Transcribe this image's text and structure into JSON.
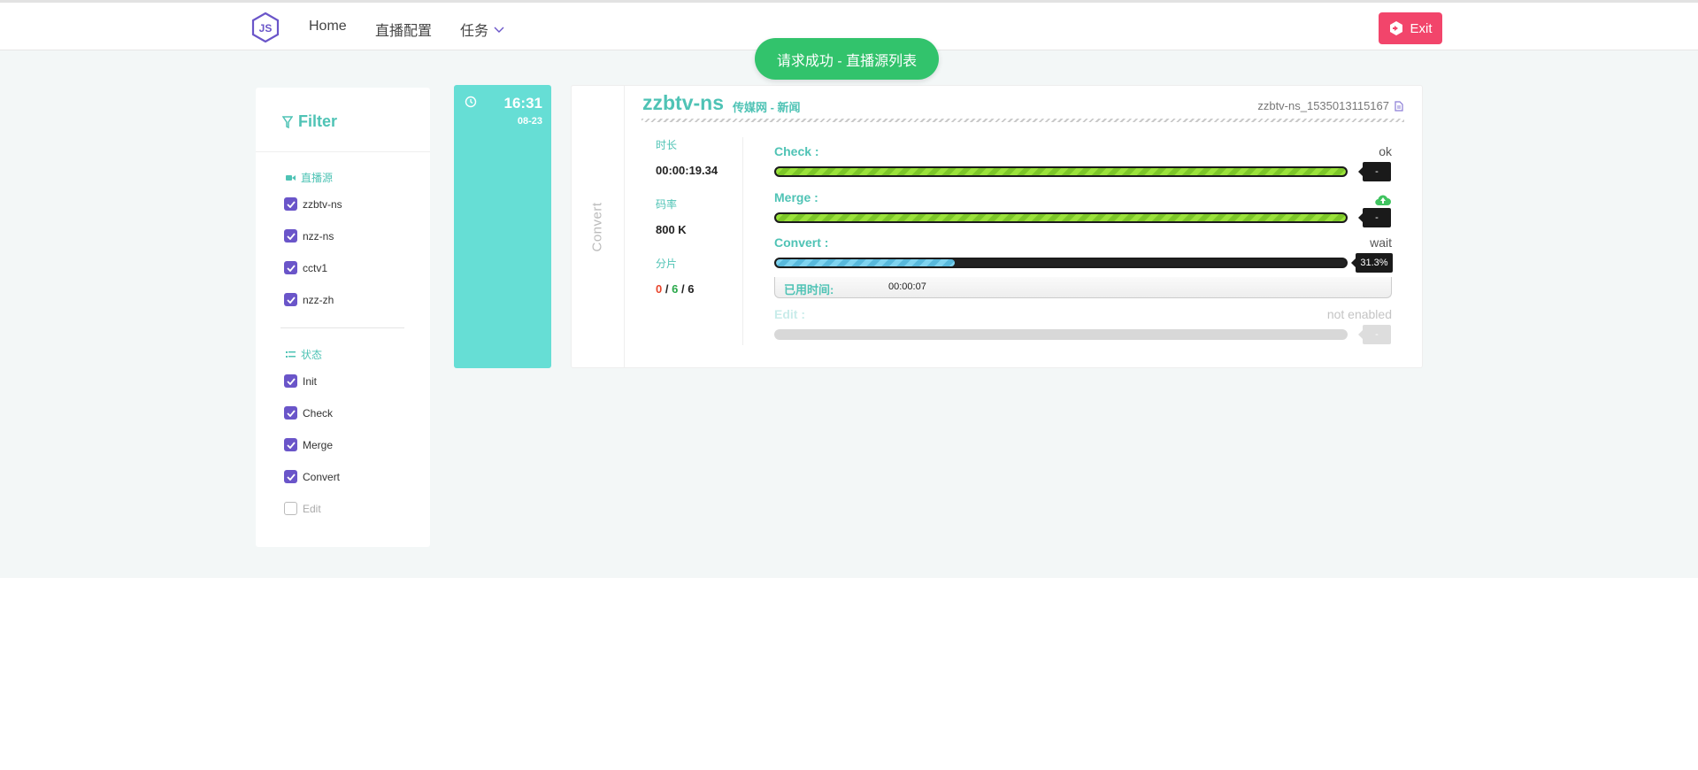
{
  "topbar": {
    "nav": [
      "Home",
      "直播配置",
      "任务"
    ],
    "exit_label": "Exit",
    "brand_color": "#6a55c9",
    "exit_color": "#f2456b"
  },
  "toast": {
    "message": "请求成功 - 直播源列表",
    "color": "#32c36c"
  },
  "filter": {
    "title": "Filter",
    "sources_title": "直播源",
    "sources": [
      {
        "label": "zzbtv-ns",
        "checked": true
      },
      {
        "label": "nzz-ns",
        "checked": true
      },
      {
        "label": "cctv1",
        "checked": true
      },
      {
        "label": "nzz-zh",
        "checked": true
      }
    ],
    "status_title": "状态",
    "statuses": [
      {
        "label": "Init",
        "checked": true
      },
      {
        "label": "Check",
        "checked": true
      },
      {
        "label": "Merge",
        "checked": true
      },
      {
        "label": "Convert",
        "checked": true
      },
      {
        "label": "Edit",
        "checked": false
      }
    ]
  },
  "task": {
    "time": "16:31",
    "date": "08-23",
    "stage": "Convert",
    "name": "zzbtv-ns",
    "subtitle": "传媒网 - 新闻",
    "id": "zzbtv-ns_1535013115167",
    "stats": {
      "duration_label": "时长",
      "duration": "00:00:19.34",
      "bitrate_label": "码率",
      "bitrate": "800 K",
      "segments_label": "分片",
      "segments_failed": "0",
      "segments_done": "6",
      "segments_total": "6",
      "sep": "/"
    },
    "processes": {
      "check": {
        "label": "Check :",
        "status": "ok",
        "progress": 1.0,
        "tag": "-"
      },
      "merge": {
        "label": "Merge :",
        "status_icon": "cloud-upload-icon",
        "progress": 1.0,
        "tag": "-"
      },
      "convert": {
        "label": "Convert :",
        "status": "wait",
        "progress": 0.313,
        "tag": "31.3%",
        "elapsed_label": "已用时间:",
        "elapsed": "00:00:07"
      },
      "edit": {
        "label": "Edit :",
        "status": "not enabled",
        "progress": 0,
        "tag": "-"
      }
    }
  }
}
